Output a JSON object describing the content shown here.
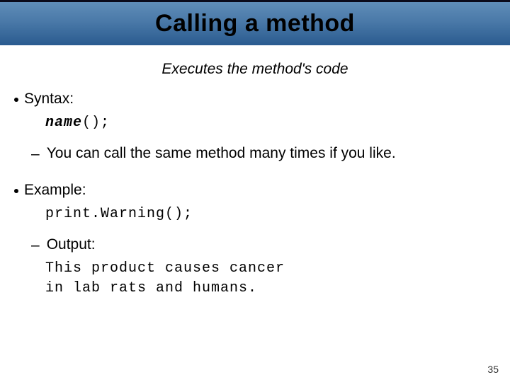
{
  "title": "Calling a method",
  "subtitle": "Executes the method's code",
  "syntax": {
    "label": "Syntax:",
    "name_part": "name",
    "call_part": "();",
    "note": "You can call the same method many times if you like."
  },
  "example": {
    "label": "Example:",
    "code": "print.Warning();",
    "output_label": "Output:",
    "output_line1": "This product causes cancer",
    "output_line2": "in lab rats and humans."
  },
  "page_number": "35"
}
